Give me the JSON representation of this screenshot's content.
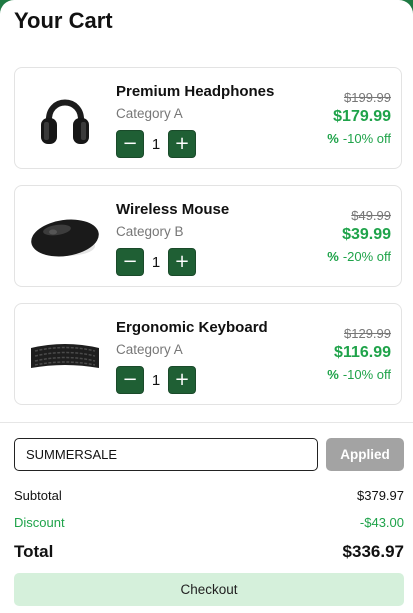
{
  "cart": {
    "title": "Your Cart"
  },
  "items": [
    {
      "name": "Premium Headphones",
      "category": "Category A",
      "quantity": "1",
      "original_price": "$199.99",
      "price": "$179.99",
      "discount_icon": "%",
      "discount_text": "-10% off",
      "image_icon": "headphones-image"
    },
    {
      "name": "Wireless Mouse",
      "category": "Category B",
      "quantity": "1",
      "original_price": "$49.99",
      "price": "$39.99",
      "discount_icon": "%",
      "discount_text": "-20% off",
      "image_icon": "mouse-image"
    },
    {
      "name": "Ergonomic Keyboard",
      "category": "Category A",
      "quantity": "1",
      "original_price": "$129.99",
      "price": "$116.99",
      "discount_icon": "%",
      "discount_text": "-10% off",
      "image_icon": "keyboard-image"
    }
  ],
  "controls": {
    "minus": "−",
    "plus": "+"
  },
  "promo": {
    "value": "SUMMERSALE",
    "button_label": "Applied"
  },
  "summary": {
    "subtotal_label": "Subtotal",
    "subtotal_value": "$379.97",
    "discount_label": "Discount",
    "discount_value": "-$43.00",
    "total_label": "Total",
    "total_value": "$336.97"
  },
  "checkout": {
    "label": "Checkout"
  },
  "colors": {
    "accent": "#1f7a43",
    "button": "#1f5f34",
    "discount_green": "#1fa34a",
    "checkout_bg": "#d5f0db",
    "applied_bg": "#a3a3a3"
  }
}
